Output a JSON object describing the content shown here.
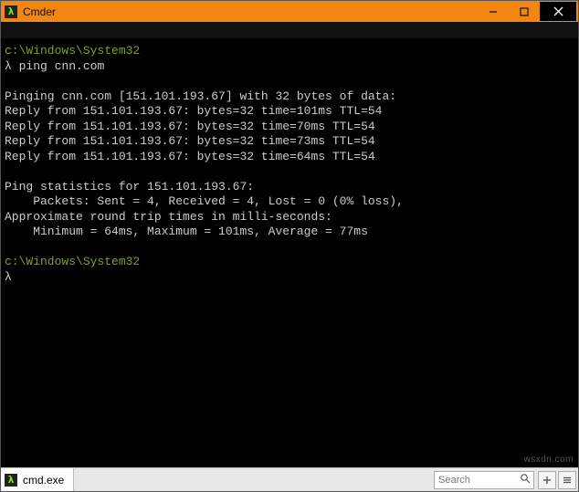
{
  "window": {
    "title": "Cmder",
    "icon_glyph": "λ"
  },
  "prompt": {
    "path": "c:\\Windows\\System32",
    "lambda": "λ",
    "command": "ping cnn.com"
  },
  "output": {
    "l1": "Pinging cnn.com [151.101.193.67] with 32 bytes of data:",
    "l2": "Reply from 151.101.193.67: bytes=32 time=101ms TTL=54",
    "l3": "Reply from 151.101.193.67: bytes=32 time=70ms TTL=54",
    "l4": "Reply from 151.101.193.67: bytes=32 time=73ms TTL=54",
    "l5": "Reply from 151.101.193.67: bytes=32 time=64ms TTL=54",
    "l6": "Ping statistics for 151.101.193.67:",
    "l7": "    Packets: Sent = 4, Received = 4, Lost = 0 (0% loss),",
    "l8": "Approximate round trip times in milli-seconds:",
    "l9": "    Minimum = 64ms, Maximum = 101ms, Average = 77ms"
  },
  "prompt2": {
    "path": "c:\\Windows\\System32",
    "lambda": "λ"
  },
  "tab": {
    "icon_glyph": "λ",
    "label": "cmd.exe"
  },
  "search": {
    "placeholder": "Search"
  },
  "watermark": "wsxdn.com"
}
